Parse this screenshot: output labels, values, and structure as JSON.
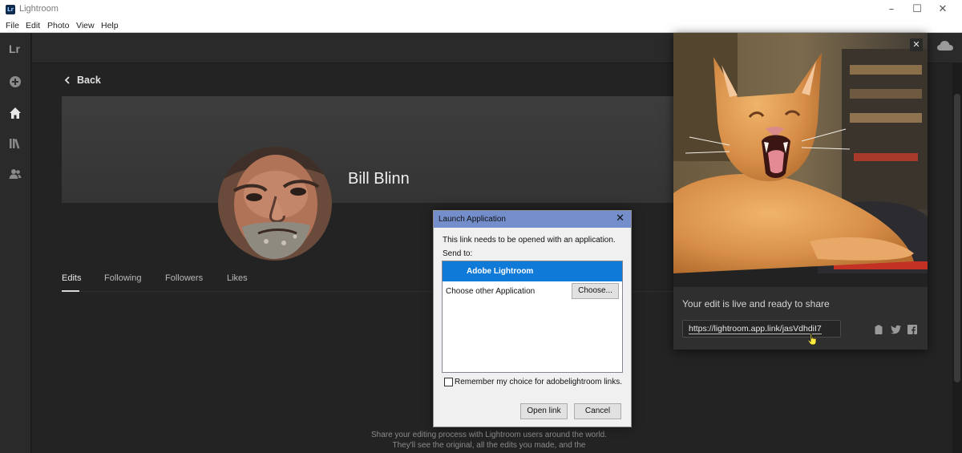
{
  "window": {
    "title": "Lightroom",
    "logo": "Lr"
  },
  "menu": [
    "File",
    "Edit",
    "Photo",
    "View",
    "Help"
  ],
  "sidebar": {
    "logo": "Lr",
    "icons": [
      "add-icon",
      "home-icon",
      "library-icon",
      "people-icon"
    ]
  },
  "topbar": {
    "cloud_icon": "cloud-icon"
  },
  "profile": {
    "back_label": "Back",
    "name": "Bill Blinn",
    "tabs": [
      "Edits",
      "Following",
      "Followers",
      "Likes"
    ],
    "active_tab": "Edits",
    "empty_text": "Share your editing process with Lightroom users around the world. They'll see the original, all the edits you made, and the"
  },
  "share_panel": {
    "message": "Your edit is live and ready to share",
    "link": "https://lightroom.app.link/jasVdhdiI7",
    "icons": [
      "clipboard-icon",
      "twitter-icon",
      "facebook-icon"
    ]
  },
  "dialog": {
    "title": "Launch Application",
    "message": "This link needs to be opened with an application.",
    "send_to": "Send to:",
    "selected_app": "Adobe Lightroom",
    "other_app": "Choose other Application",
    "choose_button": "Choose...",
    "remember_label": "Remember my choice for adobelightroom links.",
    "open_button": "Open link",
    "cancel_button": "Cancel"
  },
  "colors": {
    "accent": "#0f7ad8",
    "dialog_title": "#738ecb",
    "background": "#232323"
  }
}
